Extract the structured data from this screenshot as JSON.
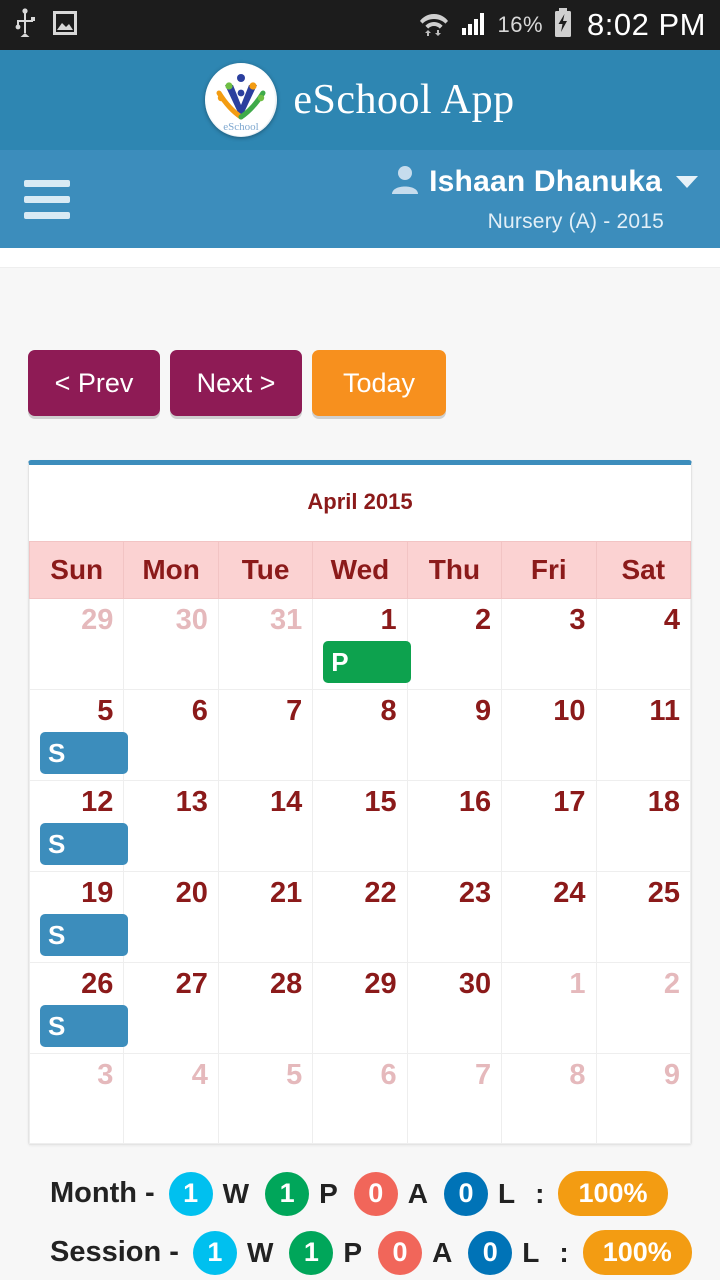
{
  "statusbar": {
    "icons": [
      "usb-icon",
      "image-icon",
      "wifi-icon",
      "signal-icon",
      "battery-charging-icon"
    ],
    "battery": "16%",
    "clock": "8:02 PM"
  },
  "brand": {
    "title": "eSchool App",
    "logo_icon": "eschool-logo-icon"
  },
  "userbar": {
    "menu_icon": "hamburger-menu-icon",
    "user_icon": "user-avatar-icon",
    "username": "Ishaan Dhanuka",
    "caret_icon": "chevron-down-icon",
    "class_label": "Nursery (A) - 2015"
  },
  "nav": {
    "prev_label": "< Prev",
    "next_label": "Next >",
    "today_label": "Today"
  },
  "calendar": {
    "title": "April 2015",
    "weekdays": [
      "Sun",
      "Mon",
      "Tue",
      "Wed",
      "Thu",
      "Fri",
      "Sat"
    ],
    "weeks": [
      [
        {
          "d": "29",
          "other": true,
          "badge": ""
        },
        {
          "d": "30",
          "other": true,
          "badge": ""
        },
        {
          "d": "31",
          "other": true,
          "badge": ""
        },
        {
          "d": "1",
          "other": false,
          "badge": "P"
        },
        {
          "d": "2",
          "other": false,
          "badge": ""
        },
        {
          "d": "3",
          "other": false,
          "badge": ""
        },
        {
          "d": "4",
          "other": false,
          "badge": ""
        }
      ],
      [
        {
          "d": "5",
          "other": false,
          "badge": "S"
        },
        {
          "d": "6",
          "other": false,
          "badge": ""
        },
        {
          "d": "7",
          "other": false,
          "badge": ""
        },
        {
          "d": "8",
          "other": false,
          "badge": ""
        },
        {
          "d": "9",
          "other": false,
          "badge": ""
        },
        {
          "d": "10",
          "other": false,
          "badge": ""
        },
        {
          "d": "11",
          "other": false,
          "badge": ""
        }
      ],
      [
        {
          "d": "12",
          "other": false,
          "badge": "S"
        },
        {
          "d": "13",
          "other": false,
          "badge": ""
        },
        {
          "d": "14",
          "other": false,
          "badge": ""
        },
        {
          "d": "15",
          "other": false,
          "badge": ""
        },
        {
          "d": "16",
          "other": false,
          "badge": ""
        },
        {
          "d": "17",
          "other": false,
          "badge": ""
        },
        {
          "d": "18",
          "other": false,
          "badge": ""
        }
      ],
      [
        {
          "d": "19",
          "other": false,
          "badge": "S"
        },
        {
          "d": "20",
          "other": false,
          "badge": ""
        },
        {
          "d": "21",
          "other": false,
          "badge": ""
        },
        {
          "d": "22",
          "other": false,
          "badge": ""
        },
        {
          "d": "23",
          "other": false,
          "badge": ""
        },
        {
          "d": "24",
          "other": false,
          "badge": ""
        },
        {
          "d": "25",
          "other": false,
          "badge": ""
        }
      ],
      [
        {
          "d": "26",
          "other": false,
          "badge": "S"
        },
        {
          "d": "27",
          "other": false,
          "badge": ""
        },
        {
          "d": "28",
          "other": false,
          "badge": ""
        },
        {
          "d": "29",
          "other": false,
          "badge": ""
        },
        {
          "d": "30",
          "other": false,
          "badge": ""
        },
        {
          "d": "1",
          "other": true,
          "badge": ""
        },
        {
          "d": "2",
          "other": true,
          "badge": ""
        }
      ],
      [
        {
          "d": "3",
          "other": true,
          "badge": ""
        },
        {
          "d": "4",
          "other": true,
          "badge": ""
        },
        {
          "d": "5",
          "other": true,
          "badge": ""
        },
        {
          "d": "6",
          "other": true,
          "badge": ""
        },
        {
          "d": "7",
          "other": true,
          "badge": ""
        },
        {
          "d": "8",
          "other": true,
          "badge": ""
        },
        {
          "d": "9",
          "other": true,
          "badge": ""
        }
      ]
    ]
  },
  "summary": [
    {
      "label": "Month -",
      "counts": [
        {
          "value": "1",
          "code": "W",
          "color": "#00c0ef"
        },
        {
          "value": "1",
          "code": "P",
          "color": "#00a65a"
        },
        {
          "value": "0",
          "code": "A",
          "color": "#f1665a"
        },
        {
          "value": "0",
          "code": "L",
          "color": "#0073b7"
        }
      ],
      "separator": ":",
      "percent": "100%"
    },
    {
      "label": "Session -",
      "counts": [
        {
          "value": "1",
          "code": "W",
          "color": "#00c0ef"
        },
        {
          "value": "1",
          "code": "P",
          "color": "#00a65a"
        },
        {
          "value": "0",
          "code": "A",
          "color": "#f1665a"
        },
        {
          "value": "0",
          "code": "L",
          "color": "#0073b7"
        }
      ],
      "separator": ":",
      "percent": "100%"
    }
  ],
  "colors": {
    "brand_blue": "#2e86b2",
    "header_blue": "#3c8dbc",
    "maroon": "#8e1b55",
    "orange": "#f7901e",
    "present_green": "#0da24e",
    "sunday_blue": "#3c8dbc",
    "pink_header": "#fbd2d2",
    "dark_red_text": "#8b1a1a"
  }
}
